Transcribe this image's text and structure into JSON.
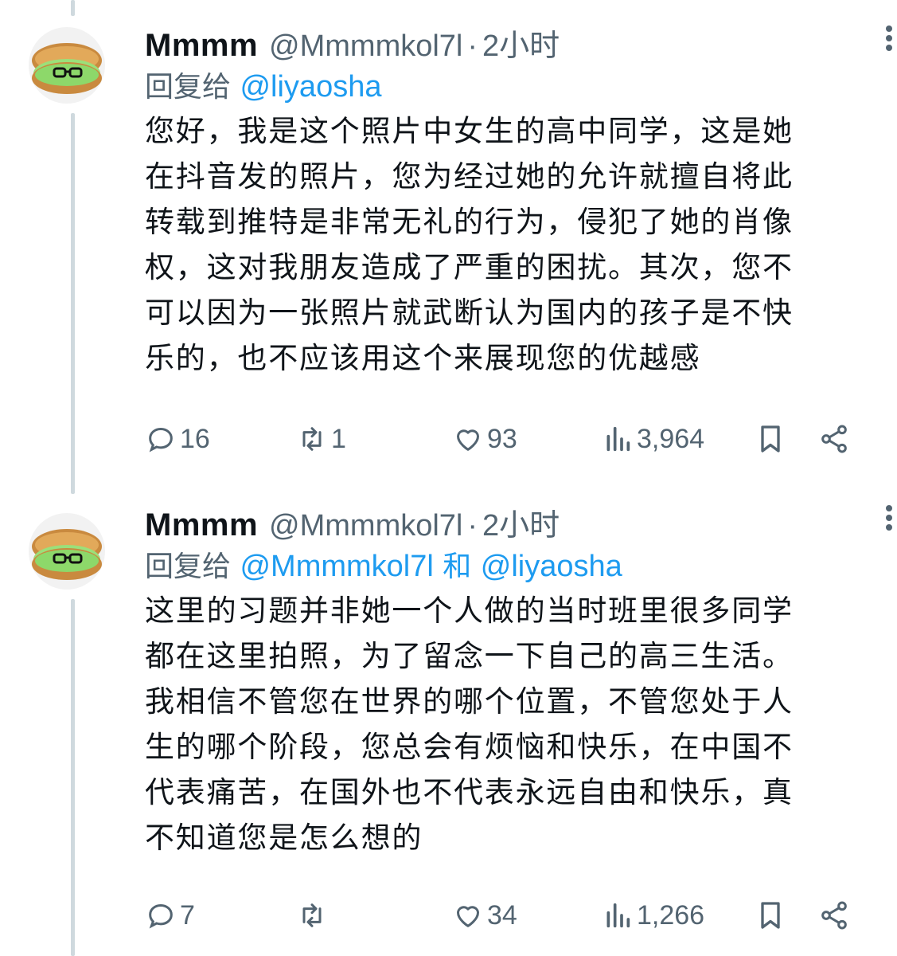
{
  "tweets": [
    {
      "name": "Mmmm",
      "handle": "@Mmmmkol7l",
      "dot": "·",
      "time": "2小时",
      "reply_prefix": "回复给",
      "reply_mention_1": "@liyaosha",
      "reply_and": "",
      "reply_mention_2": "",
      "body": "您好，我是这个照片中女生的高中同学，这是她\n在抖音发的照片，您为经过她的允许就擅自将此\n转载到推特是非常无礼的行为，侵犯了她的肖像\n权，这对我朋友造成了严重的困扰。其次，您不\n可以因为一张照片就武断认为国内的孩子是不快\n乐的，也不应该用这个来展现您的优越感",
      "replies": "16",
      "retweets": "1",
      "likes": "93",
      "views": "3,964"
    },
    {
      "name": "Mmmm",
      "handle": "@Mmmmkol7l",
      "dot": "·",
      "time": "2小时",
      "reply_prefix": "回复给",
      "reply_mention_1": "@Mmmmkol7l",
      "reply_and": "和",
      "reply_mention_2": "@liyaosha",
      "body": "这里的习题并非她一个人做的当时班里很多同学\n都在这里拍照，为了留念一下自己的高三生活。\n我相信不管您在世界的哪个位置，不管您处于人\n生的哪个阶段，您总会有烦恼和快乐，在中国不\n代表痛苦，在国外也不代表永远自由和快乐，真\n不知道您是怎么想的",
      "replies": "7",
      "retweets": "",
      "likes": "34",
      "views": "1,266"
    }
  ],
  "colors": {
    "text": "#0f1419",
    "secondary": "#536471",
    "link": "#1d9bf0",
    "thread_line": "#cfd9de"
  },
  "icons": [
    "more-icon",
    "reply-icon",
    "retweet-icon",
    "like-icon",
    "views-icon",
    "bookmark-icon",
    "share-icon"
  ]
}
